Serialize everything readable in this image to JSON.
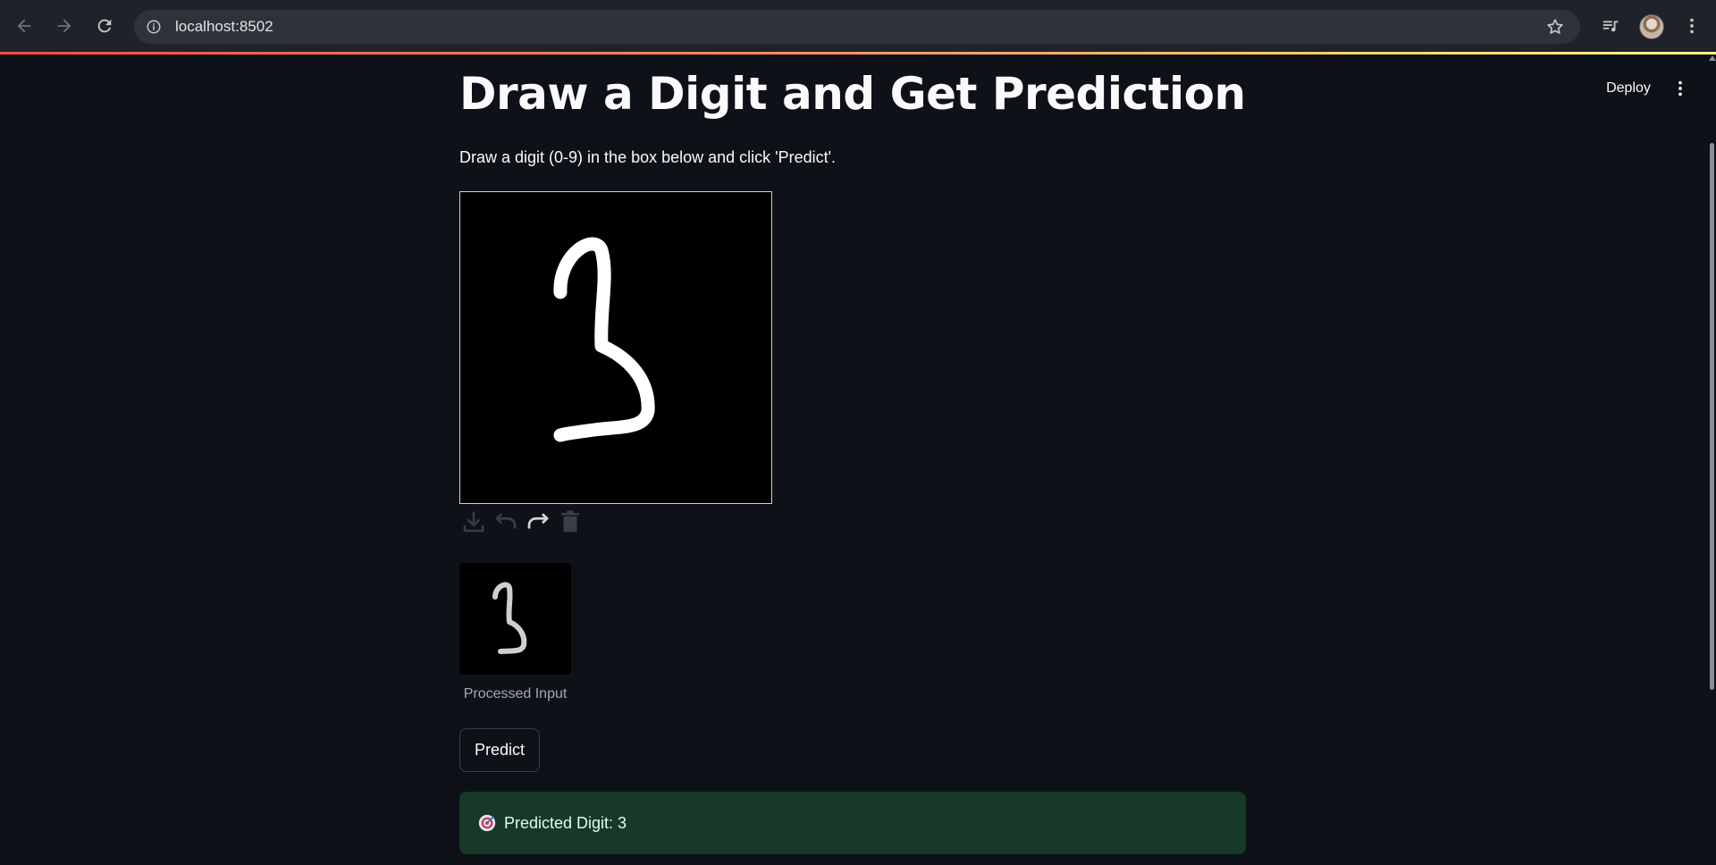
{
  "browser": {
    "url": "localhost:8502",
    "icons": {
      "back": "arrow-left-icon",
      "forward": "arrow-right-icon",
      "reload": "reload-icon",
      "site_info": "site-info-icon",
      "bookmark": "star-icon",
      "media": "media-queue-icon",
      "menu": "kebab-menu-icon"
    }
  },
  "app_header": {
    "deploy_label": "Deploy"
  },
  "main": {
    "title": "Draw a Digit and Get Prediction",
    "instructions": "Draw a digit (0-9) in the box below and click 'Predict'.",
    "canvas_tools": [
      "download-icon",
      "undo-icon",
      "redo-icon",
      "trash-icon"
    ],
    "processed_caption": "Processed Input",
    "predict_label": "Predict",
    "result_text": "Predicted Digit: 3"
  },
  "colors": {
    "background": "#0e1117",
    "success_bg": "#173928",
    "accent_gradient_start": "#ff4b4b",
    "accent_gradient_end": "#fffd80"
  }
}
